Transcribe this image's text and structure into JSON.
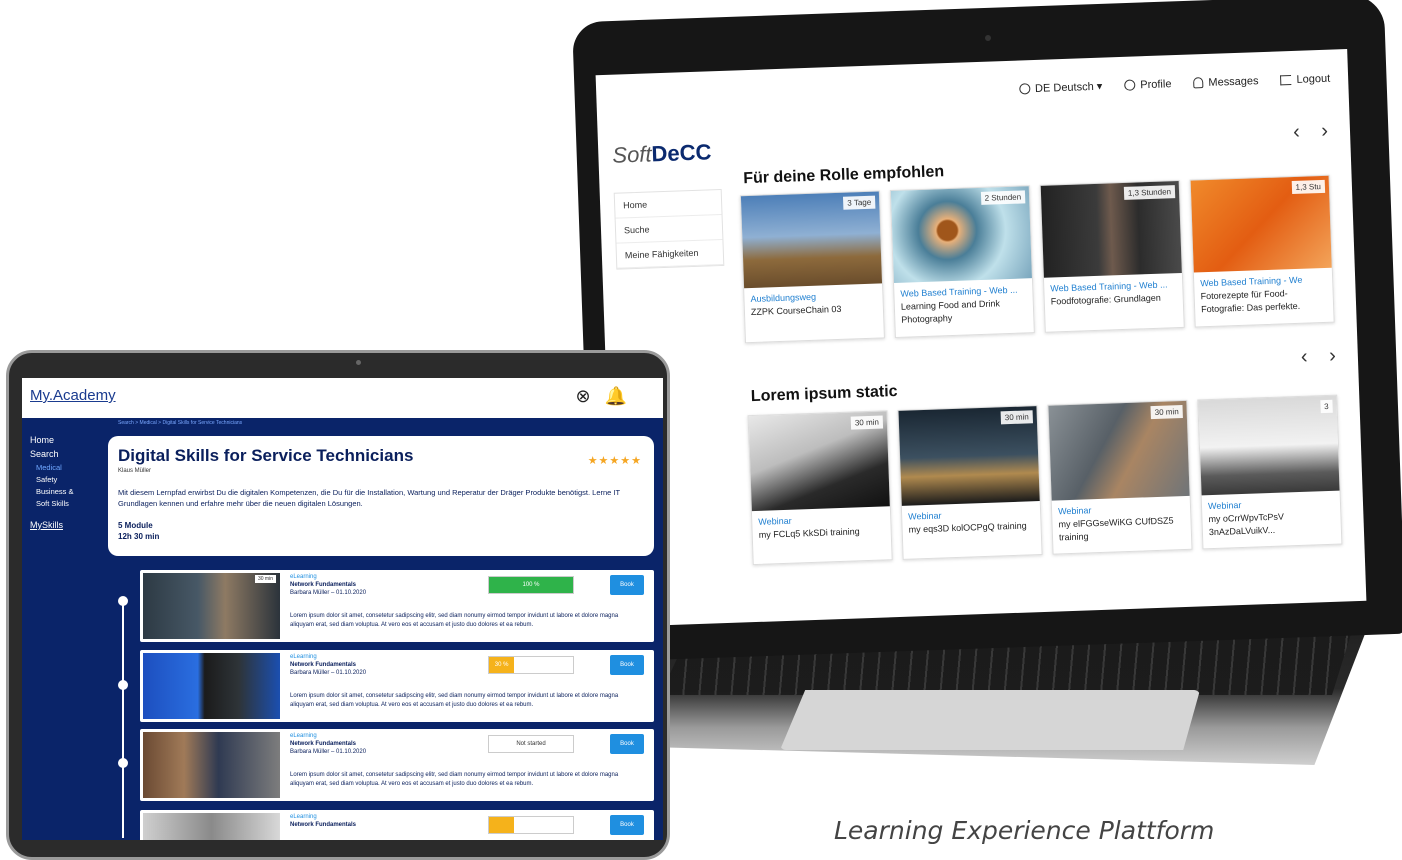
{
  "laptop": {
    "logo_prefix": "Soft",
    "logo_bold": "DeCC",
    "topnav": {
      "language": "DE Deutsch ▾",
      "profile": "Profile",
      "messages": "Messages",
      "logout": "Logout"
    },
    "sidebar": [
      "Home",
      "Suche",
      "Meine Fähigkeiten"
    ],
    "section1": {
      "title": "Für deine Rolle empfohlen",
      "arrows": "‹ ›",
      "cards": [
        {
          "duration": "3 Tage",
          "type": "Ausbildungsweg",
          "name": "ZZPK CourseChain 03"
        },
        {
          "duration": "2 Stunden",
          "type": "Web Based Training - Web ...",
          "name": "Learning Food and Drink Photography"
        },
        {
          "duration": "1,3 Stunden",
          "type": "Web Based Training - Web ...",
          "name": "Foodfotografie: Grundlagen"
        },
        {
          "duration": "1,3 Stu",
          "type": "Web Based Training - We",
          "name": "Fotorezepte für Food-Fotografie: Das perfekte."
        }
      ]
    },
    "section2": {
      "title": "Lorem ipsum static",
      "arrows": "‹ ›",
      "cards": [
        {
          "duration": "30 min",
          "type": "Webinar",
          "name": "my FCLq5 KkSDi training"
        },
        {
          "duration": "30 min",
          "type": "Webinar",
          "name": "my eqs3D kolOCPgQ training"
        },
        {
          "duration": "30 min",
          "type": "Webinar",
          "name": "my elFGGseWiKG CUfDSZ5 training"
        },
        {
          "duration": "3",
          "type": "Webinar",
          "name": "my oCrrWpvTcPsV 3nAzDaLVuikV..."
        }
      ]
    }
  },
  "tablet": {
    "logo": "My.Academy",
    "icons": {
      "profile": "⊗",
      "bell": "🔔"
    },
    "breadcrumb": "Search > Medical > Digital Skills for Service Technicians",
    "nav": {
      "home": "Home",
      "search": "Search",
      "medical": "Medical",
      "safety": "Safety",
      "business": "Business &",
      "soft": "Soft Skills",
      "myskills": "MySkills"
    },
    "course": {
      "title": "Digital Skills for Service Technicians",
      "author": "Klaus Müller",
      "stars": "★★★★★",
      "rating": 5,
      "description": "Mit diesem Lernpfad erwirbst Du die digitalen Kompetenzen, die Du für die Installation, Wartung und Reperatur der Dräger Produkte benötigst. Lerne IT Grundlagen kennen und erfahre mehr über die neuen digitalen Lösungen.",
      "modules": "5 Module",
      "duration": "12h 30 min"
    },
    "items": [
      {
        "tag": "30 min",
        "type": "eLearning",
        "name": "Network Fundamentals",
        "meta": "Barbara Müller – 01.10.2020",
        "progress_label": "100 %",
        "progress": 1.0,
        "color": "#2fb34a",
        "book": "Book",
        "lorem": "Lorem ipsum dolor sit amet, consetetur sadipscing elitr, sed diam nonumy eirmod tempor invidunt ut labore et dolore magna aliquyam erat, sed diam voluptua. At vero eos et accusam et justo duo dolores et ea rebum."
      },
      {
        "tag": "",
        "type": "eLearning",
        "name": "Network Fundamentals",
        "meta": "Barbara Müller – 01.10.2020",
        "progress_label": "30 %",
        "progress": 0.3,
        "color": "#f5b21b",
        "book": "Book",
        "lorem": "Lorem ipsum dolor sit amet, consetetur sadipscing elitr, sed diam nonumy eirmod tempor invidunt ut labore et dolore magna aliquyam erat, sed diam voluptua. At vero eos et accusam et justo duo dolores et ea rebum."
      },
      {
        "tag": "",
        "type": "eLearning",
        "name": "Network Fundamentals",
        "meta": "Barbara Müller – 01.10.2020",
        "progress_label": "Not started",
        "progress": 0,
        "color": "#ffffff",
        "book": "Book",
        "lorem": "Lorem ipsum dolor sit amet, consetetur sadipscing elitr, sed diam nonumy eirmod tempor invidunt ut labore et dolore magna aliquyam erat, sed diam voluptua. At vero eos et accusam et justo duo dolores et ea rebum."
      },
      {
        "tag": "",
        "type": "eLearning",
        "name": "Network Fundamentals",
        "meta": "",
        "progress_label": "",
        "progress": 0.3,
        "color": "#f5b21b",
        "book": "Book",
        "lorem": ""
      }
    ]
  },
  "caption": "Learning Experience Plattform"
}
